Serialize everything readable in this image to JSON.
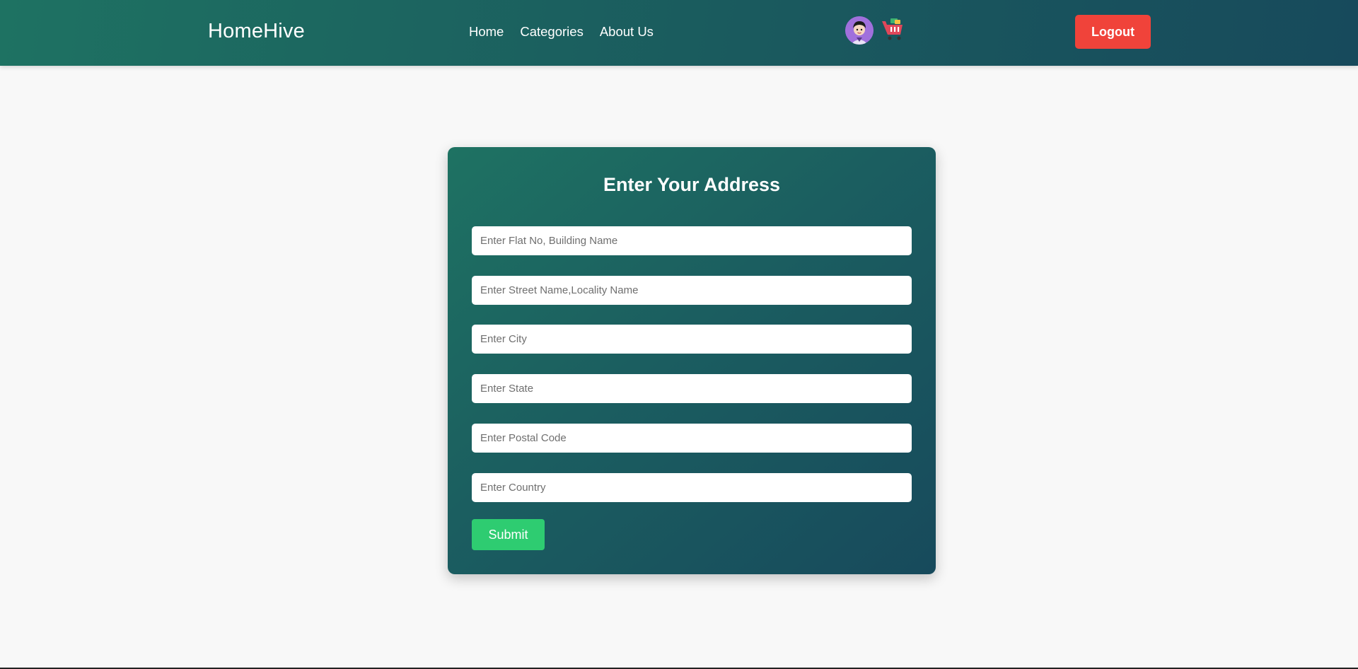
{
  "header": {
    "brand": "HomeHive",
    "nav": [
      {
        "label": "Home"
      },
      {
        "label": "Categories"
      },
      {
        "label": "About Us"
      }
    ],
    "icons": [
      "avatar-icon",
      "cart-icon"
    ],
    "logout_label": "Logout"
  },
  "form": {
    "title": "Enter Your Address",
    "fields": [
      {
        "placeholder": "Enter Flat No, Building Name",
        "value": ""
      },
      {
        "placeholder": "Enter Street Name,Locality Name",
        "value": ""
      },
      {
        "placeholder": "Enter City",
        "value": ""
      },
      {
        "placeholder": "Enter State",
        "value": ""
      },
      {
        "placeholder": "Enter Postal Code",
        "value": ""
      },
      {
        "placeholder": "Enter Country",
        "value": ""
      }
    ],
    "submit_label": "Submit"
  },
  "colors": {
    "header_gradient_start": "#1e7262",
    "header_gradient_end": "#174a5c",
    "logout": "#f0433a",
    "submit": "#2ecc71",
    "page_background": "#f8f8f8"
  }
}
